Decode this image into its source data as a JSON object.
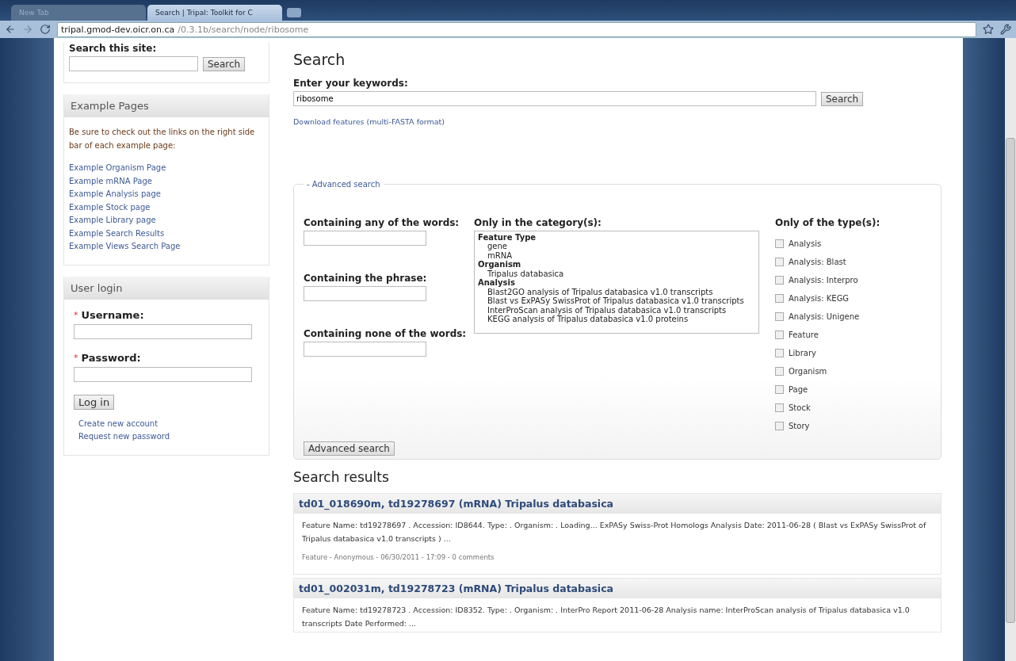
{
  "browser": {
    "tabs": [
      {
        "label": "New Tab",
        "selected": false
      },
      {
        "label": "Search | Tripal: Toolkit for C",
        "selected": true
      }
    ],
    "url": {
      "host": "tripal.gmod-dev.oicr.on.ca",
      "path": "/0.3.1b/search/node/ribosome"
    }
  },
  "sidebar": {
    "site_search": {
      "label": "Search this site:",
      "button": "Search"
    },
    "example_pages": {
      "title": "Example Pages",
      "intro": "Be sure to check out the links on the right side bar of each example page:",
      "links": [
        "Example Organism Page",
        "Example mRNA Page",
        "Example Analysis page",
        "Example Stock page",
        "Example Library page",
        "Example Search Results",
        "Example Views Search Page"
      ]
    },
    "login": {
      "title": "User login",
      "fields": [
        {
          "label": "Username:",
          "required_mark": "*"
        },
        {
          "label": "Password:",
          "required_mark": "*"
        }
      ],
      "button": "Log in",
      "links": [
        "Create new account",
        "Request new password"
      ]
    }
  },
  "main": {
    "title": "Search",
    "keywords": {
      "label": "Enter your keywords:",
      "value": "ribosome",
      "button": "Search"
    },
    "download_link": "Download features (multi-FASTA format)",
    "advanced": {
      "toggle": "-",
      "legend": "Advanced search",
      "expanded": true,
      "fields": [
        {
          "label": "Containing any of the words:"
        },
        {
          "label": "Containing the phrase:"
        },
        {
          "label": "Containing none of the words:"
        }
      ],
      "category": {
        "label": "Only in the category(s):",
        "groups": [
          {
            "label": "Feature Type",
            "children": [
              {
                "label": "gene"
              },
              {
                "label": "mRNA"
              }
            ]
          },
          {
            "label": "Organism",
            "children": [
              {
                "label": "Tripalus databasica"
              }
            ]
          },
          {
            "label": "Analysis",
            "children": [
              {
                "label": "Blast2GO analysis of Tripalus databasica v1.0 transcripts"
              },
              {
                "label": "Blast vs ExPASy SwissProt of Tripalus databasica v1.0 transcripts"
              },
              {
                "label": "InterProScan analysis of Tripalus databasica v1.0 transcripts"
              },
              {
                "label": "KEGG analysis of Tripalus databasica v1.0 proteins"
              }
            ]
          }
        ]
      },
      "types": {
        "label": "Only of the type(s):",
        "options": [
          {
            "label": "Analysis",
            "checked": false
          },
          {
            "label": "Analysis: Blast",
            "checked": false
          },
          {
            "label": "Analysis: Interpro",
            "checked": false
          },
          {
            "label": "Analysis: KEGG",
            "checked": false
          },
          {
            "label": "Analysis: Unigene",
            "checked": false
          },
          {
            "label": "Feature",
            "checked": false
          },
          {
            "label": "Library",
            "checked": false
          },
          {
            "label": "Organism",
            "checked": false
          },
          {
            "label": "Page",
            "checked": false
          },
          {
            "label": "Stock",
            "checked": false
          },
          {
            "label": "Story",
            "checked": false
          }
        ]
      },
      "button": "Advanced search"
    },
    "results": {
      "title": "Search results",
      "items": [
        {
          "title": "td01_018690m, td19278697 (mRNA) Tripalus databasica",
          "snippet": "Feature Name: td19278697 . Accession: ID8644. Type: . Organism: . Loading... ExPASy Swiss-Prot Homologs Analysis Date: 2011-06-28 ( Blast vs ExPASy SwissProt of Tripalus databasica v1.0 transcripts ) ...",
          "meta": "Feature - Anonymous - 06/30/2011 - 17:09 - 0 comments"
        },
        {
          "title": "td01_002031m, td19278723 (mRNA) Tripalus databasica",
          "snippet": "Feature Name: td19278723 . Accession: ID8352. Type: . Organism: . InterPro Report 2011-06-28 Analysis name: InterProScan analysis of Tripalus databasica v1.0 transcripts Date Performed: ..."
        }
      ]
    }
  }
}
